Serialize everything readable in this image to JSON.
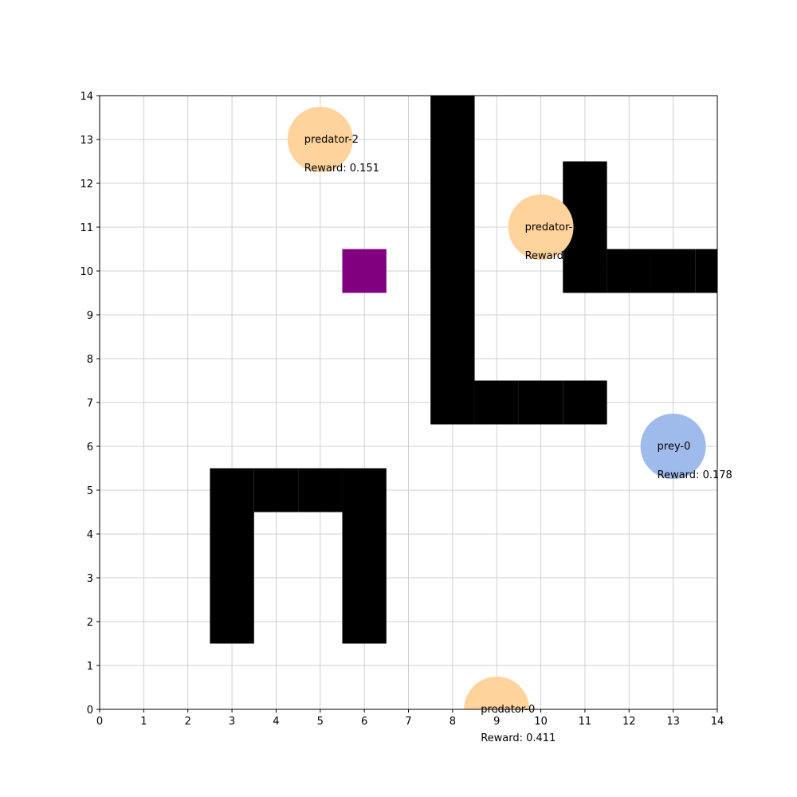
{
  "chart_data": {
    "type": "scatter",
    "xlim": [
      0,
      14
    ],
    "ylim": [
      0,
      14
    ],
    "xticks": [
      "0",
      "1",
      "2",
      "3",
      "4",
      "5",
      "6",
      "7",
      "8",
      "9",
      "10",
      "11",
      "12",
      "13",
      "14"
    ],
    "yticks": [
      "0",
      "1",
      "2",
      "3",
      "4",
      "5",
      "6",
      "7",
      "8",
      "9",
      "10",
      "11",
      "12",
      "13",
      "14"
    ],
    "grid": true,
    "walls": [
      [
        8,
        7
      ],
      [
        8,
        8
      ],
      [
        8,
        9
      ],
      [
        8,
        10
      ],
      [
        8,
        11
      ],
      [
        8,
        12
      ],
      [
        8,
        13
      ],
      [
        8,
        14
      ],
      [
        9,
        7
      ],
      [
        10,
        7
      ],
      [
        11,
        7
      ],
      [
        11,
        10
      ],
      [
        11,
        11
      ],
      [
        11,
        12
      ],
      [
        12,
        10
      ],
      [
        13,
        10
      ],
      [
        14,
        10
      ],
      [
        3,
        2
      ],
      [
        3,
        3
      ],
      [
        3,
        4
      ],
      [
        3,
        5
      ],
      [
        4,
        5
      ],
      [
        5,
        5
      ],
      [
        6,
        5
      ],
      [
        6,
        4
      ],
      [
        6,
        3
      ],
      [
        6,
        2
      ]
    ],
    "goal": {
      "cell": [
        6,
        10
      ],
      "color": "#800080"
    },
    "agents": [
      {
        "name": "predator-2",
        "x": 5,
        "y": 13,
        "reward_text": "Reward: 0.151",
        "color": "#ffd39b"
      },
      {
        "name": "predator-1",
        "x": 10,
        "y": 11,
        "reward_text": "Reward: ...",
        "color": "#ffd39b"
      },
      {
        "name": "prey-0",
        "x": 13,
        "y": 6,
        "reward_text": "Reward: 0.178",
        "color": "#9fbbeb"
      },
      {
        "name": "predator-0",
        "x": 9,
        "y": 0,
        "reward_text": "Reward: 0.411",
        "color": "#ffd39b"
      }
    ],
    "colors": {
      "wall": "#000000",
      "grid": "#d0d0d0"
    }
  }
}
